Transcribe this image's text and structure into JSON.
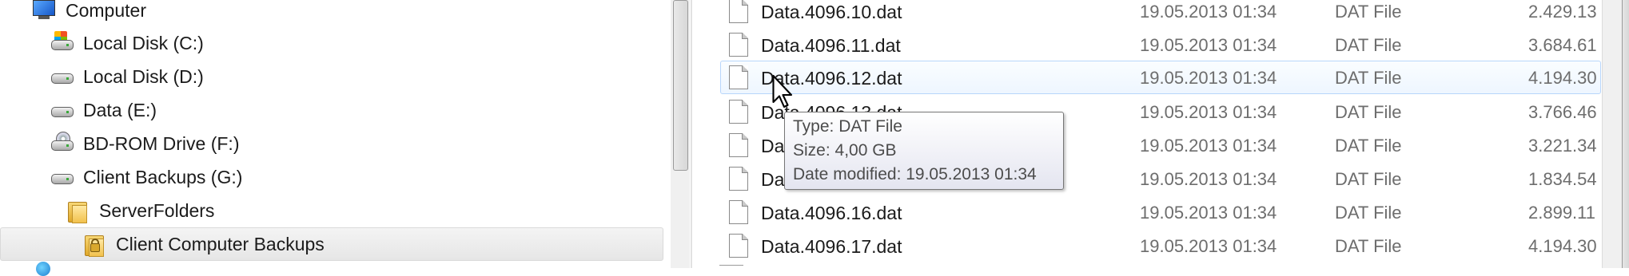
{
  "nav": {
    "items": [
      {
        "label": "Computer",
        "icon": "computer-icon"
      },
      {
        "label": "Local Disk (C:)",
        "icon": "system-drive-icon"
      },
      {
        "label": "Local Disk (D:)",
        "icon": "drive-icon"
      },
      {
        "label": "Data (E:)",
        "icon": "drive-icon"
      },
      {
        "label": "BD-ROM Drive (F:)",
        "icon": "bd-rom-icon"
      },
      {
        "label": "Client Backups (G:)",
        "icon": "drive-icon"
      },
      {
        "label": "ServerFolders",
        "icon": "folder-icon"
      },
      {
        "label": "Client Computer Backups",
        "icon": "locked-folder-icon",
        "selected": true
      }
    ]
  },
  "files": [
    {
      "name": "Data.4096.10.dat",
      "date": "19.05.2013 01:34",
      "type": "DAT File",
      "size": "2.429.13"
    },
    {
      "name": "Data.4096.11.dat",
      "date": "19.05.2013 01:34",
      "type": "DAT File",
      "size": "3.684.61"
    },
    {
      "name": "Data.4096.12.dat",
      "date": "19.05.2013 01:34",
      "type": "DAT File",
      "size": "4.194.30",
      "hover": true
    },
    {
      "name": "Data.4096.13.dat",
      "date": "19.05.2013 01:34",
      "type": "DAT File",
      "size": "3.766.46"
    },
    {
      "name": "Data.4096.14.dat",
      "date": "19.05.2013 01:34",
      "type": "DAT File",
      "size": "3.221.34"
    },
    {
      "name": "Data.4096.15.dat",
      "date": "19.05.2013 01:34",
      "type": "DAT File",
      "size": "1.834.54"
    },
    {
      "name": "Data.4096.16.dat",
      "date": "19.05.2013 01:34",
      "type": "DAT File",
      "size": "2.899.11"
    },
    {
      "name": "Data.4096.17.dat",
      "date": "19.05.2013 01:34",
      "type": "DAT File",
      "size": "4.194.30"
    }
  ],
  "tooltip": {
    "type_line": "Type: DAT File",
    "size_line": "Size: 4,00 GB",
    "date_line": "Date modified: 19.05.2013 01:34"
  }
}
